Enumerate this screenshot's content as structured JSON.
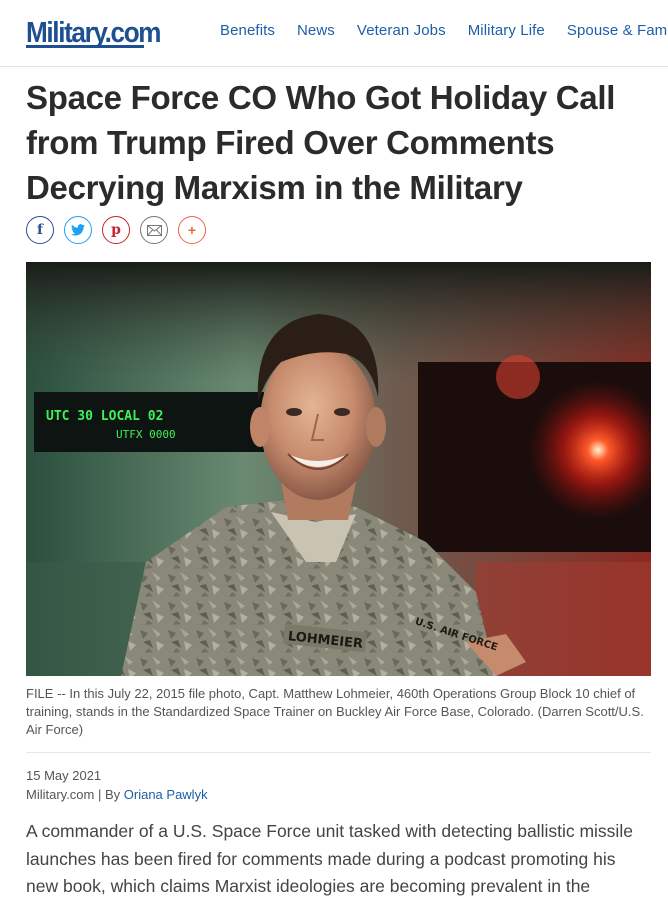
{
  "site": {
    "logo": "Military.com",
    "nav": [
      "Benefits",
      "News",
      "Veteran Jobs",
      "Military Life",
      "Spouse & Fam"
    ]
  },
  "article": {
    "headline": "Space Force CO Who Got Holiday Call from Trump Fired Over Comments Decrying Marxism in the Military",
    "share_icons": [
      "facebook-icon",
      "twitter-icon",
      "pinterest-icon",
      "email-icon",
      "more-icon"
    ],
    "photo": {
      "nametape": "LOHMEIER",
      "branch_tape": "U.S. AIR FORCE"
    },
    "caption": "FILE -- In this July 22, 2015 file photo, Capt. Matthew Lohmeier, 460th Operations Group Block 10 chief of training, stands in the Standardized Space Trainer on Buckley Air Force Base, Colorado. (Darren Scott/U.S. Air Force)",
    "date": "15 May 2021",
    "source": "Military.com | By ",
    "author": "Oriana Pawlyk",
    "body": "A commander of a U.S. Space Force unit tasked with detecting ballistic missile launches has been fired for comments made during a podcast promoting his new book, which claims Marxist ideologies are becoming prevalent in the"
  },
  "colors": {
    "brand_blue": "#1d4f91",
    "link_blue": "#1d5fa8",
    "facebook": "#2b4f8f",
    "twitter": "#1da1f2",
    "pinterest": "#c8232c",
    "more": "#e8664a"
  }
}
